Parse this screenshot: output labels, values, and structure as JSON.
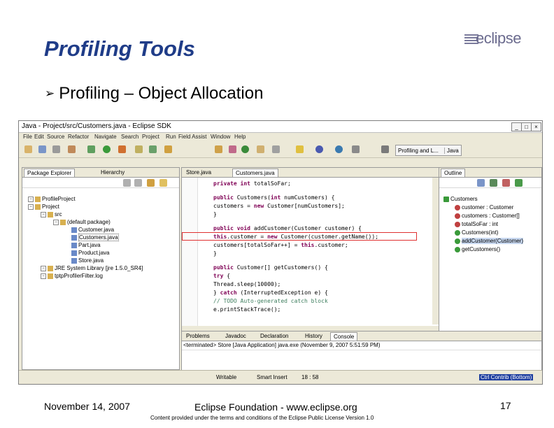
{
  "slide": {
    "title": "Profiling Tools",
    "bullet": "Profiling – Object Allocation",
    "logo_text": "eclipse",
    "footer_date": "November 14, 2007",
    "footer_org": "Eclipse Foundation - www.eclipse.org",
    "footer_license": "Content provided under the terms and conditions of the Eclipse Public License Version 1.0",
    "page_number": "17"
  },
  "window": {
    "title": "Java - Project/src/Customers.java - Eclipse SDK",
    "menu": [
      "File",
      "Edit",
      "Source",
      "Refactor",
      "Navigate",
      "Search",
      "Project",
      "Run",
      "Field Assist",
      "Window",
      "Help"
    ],
    "perspectives": {
      "profiling": "Profiling and L...",
      "java": "Java"
    }
  },
  "explorer": {
    "tabs": [
      "Package Explorer",
      "Hierarchy"
    ],
    "items": [
      {
        "label": "ProfileProject",
        "indent": 0
      },
      {
        "label": "Project",
        "indent": 0
      },
      {
        "label": "src",
        "indent": 1
      },
      {
        "label": "(default package)",
        "indent": 2
      },
      {
        "label": "Customer.java",
        "indent": 3
      },
      {
        "label": "Customers.java",
        "indent": 3
      },
      {
        "label": "Part.java",
        "indent": 3
      },
      {
        "label": "Product.java",
        "indent": 3
      },
      {
        "label": "Store.java",
        "indent": 3
      },
      {
        "label": "JRE System Library [jre 1.5.0_SR4]",
        "indent": 1
      },
      {
        "label": "tptpProfilerFilter.log",
        "indent": 1
      }
    ]
  },
  "editor": {
    "tabs": [
      "Store.java",
      "Customers.java"
    ],
    "lines": [
      "private int totalSoFar;",
      "public Customers(int numCustomers) {",
      "    customers = new Customer[numCustomers];",
      "}",
      "public void addCustomer(Customer customer) {",
      "    this.customer = new Customer(customer.getName());",
      "    customers[totalSoFar++] = this.customer;",
      "}",
      "public Customer[] getCustomers() {",
      "    try {",
      "        Thread.sleep(10000);",
      "    } catch (InterruptedException e) {",
      "        // TODO Auto-generated catch block",
      "        e.printStackTrace();"
    ]
  },
  "outline": {
    "tab": "Outline",
    "items": [
      "Customers",
      "customer : Customer",
      "customers : Customer[]",
      "totalSoFar : int",
      "Customers(int)",
      "addCustomer(Customer)",
      "getCustomers()"
    ]
  },
  "bottom": {
    "tabs": [
      "Problems",
      "Javadoc",
      "Declaration",
      "History",
      "Console"
    ],
    "console_text": "<terminated> Store [Java Application] java.exe (November 9, 2007 5:51:59 PM)"
  },
  "status": {
    "writable": "Writable",
    "insert": "Smart Insert",
    "position": "18 : 58",
    "contrib": "Ctrl Contrib (Bottom)"
  }
}
